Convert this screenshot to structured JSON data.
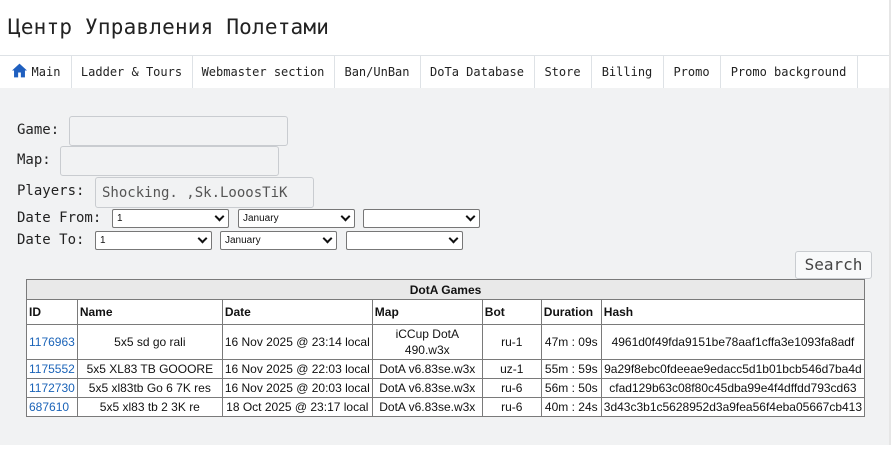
{
  "header": {
    "title": "Центр Управления Полетами"
  },
  "nav": {
    "items": [
      {
        "label": "Main",
        "icon": "home-icon"
      },
      {
        "label": "Ladder & Tours"
      },
      {
        "label": "Webmaster section"
      },
      {
        "label": "Ban/UnBan"
      },
      {
        "label": "DoTa Database"
      },
      {
        "label": "Store"
      },
      {
        "label": "Billing"
      },
      {
        "label": "Promo"
      },
      {
        "label": "Promo background"
      }
    ]
  },
  "form": {
    "game_label": "Game:",
    "game_value": "",
    "map_label": "Map:",
    "map_value": "",
    "players_label": "Players:",
    "players_value": "Shocking. ,Sk.LooosTiK",
    "date_from_label": "Date From:",
    "date_from": {
      "day": "1",
      "month": "January",
      "year": ""
    },
    "date_to_label": "Date To:",
    "date_to": {
      "day": "1",
      "month": "January",
      "year": ""
    },
    "search_label": "Search"
  },
  "table": {
    "caption": "DotA Games",
    "columns": [
      "ID",
      "Name",
      "Date",
      "Map",
      "Bot",
      "Duration",
      "Hash"
    ],
    "rows": [
      {
        "id": "1176963",
        "name": "5x5 sd go rali",
        "date": "16 Nov 2025 @ 23:14 local",
        "map": "iCCup DotA 490.w3x",
        "bot": "ru-1",
        "duration": "47m : 09s",
        "hash": "4961d0f49fda9151be78aaf1cffa3e1093fa8adf"
      },
      {
        "id": "1175552",
        "name": "5x5 XL83 TB GOOORE",
        "date": "16 Nov 2025 @ 22:03 local",
        "map": "DotA v6.83se.w3x",
        "bot": "uz-1",
        "duration": "55m : 59s",
        "hash": "9a29f8ebc0fdeeae9edacc5d1b01bcb546d7ba4d"
      },
      {
        "id": "1172730",
        "name": "5x5 xl83tb Go 6 7K res",
        "date": "16 Nov 2025 @ 20:03 local",
        "map": "DotA v6.83se.w3x",
        "bot": "ru-6",
        "duration": "56m : 50s",
        "hash": "cfad129b63c08f80c45dba99e4f4dffdd793cd63"
      },
      {
        "id": "687610",
        "name": "5x5 xl83 tb 2 3K re",
        "date": "18 Oct 2025 @ 23:17 local",
        "map": "DotA v6.83se.w3x",
        "bot": "ru-6",
        "duration": "40m : 24s",
        "hash": "3d43c3b1c5628952d3a9fea56f4eba05667cb413"
      }
    ]
  },
  "colors": {
    "link": "#1a63b8",
    "home_icon": "#1f5fbf",
    "panel_bg": "#f1f2f3"
  }
}
